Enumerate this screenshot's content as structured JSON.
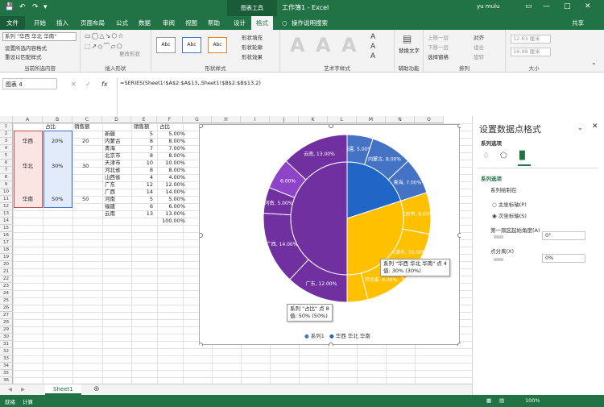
{
  "titlebar": {
    "title": "工作簿1 - Excel",
    "context_tab": "图表工具",
    "user": "yu mulu"
  },
  "tabs": [
    "文件",
    "开始",
    "插入",
    "页面布局",
    "公式",
    "数据",
    "审阅",
    "视图",
    "帮助",
    "设计",
    "格式",
    "操作说明搜索"
  ],
  "share": "共享",
  "ribbon": {
    "selector": "系列 \"华西 华北 华南\"",
    "format_selection": "设置所选内容格式",
    "reset_style": "重设以匹配样式",
    "g1": "当前所选内容",
    "g2": "插入形状",
    "change_shape": "更改形状",
    "style_sample": "Abc",
    "shape_fill": "形状填充",
    "shape_outline": "形状轮廓",
    "shape_effect": "形状效果",
    "g3": "形状样式",
    "g4": "艺术字样式",
    "alt_text": "替换文字",
    "g5": "辅助功能",
    "up": "上移一层",
    "down": "下移一层",
    "selection_pane": "选择窗格",
    "align": "对齐",
    "group": "组合",
    "rotate": "旋转",
    "g6": "排列",
    "height": "12.63 厘米",
    "width": "16.99 厘米",
    "g7": "大小"
  },
  "formula_bar": {
    "name_box": "图表 4",
    "formula": "=SERIES(Sheet1!$A$2:$A$13,,Sheet1!$B$2:$B$13,2)"
  },
  "columns": [
    "A",
    "B",
    "C",
    "D",
    "E",
    "F",
    "G",
    "H",
    "I",
    "J",
    "K",
    "L",
    "M",
    "N",
    "O"
  ],
  "rows": [
    "1",
    "2",
    "3",
    "4",
    "5",
    "6",
    "7",
    "8",
    "9",
    "10",
    "11",
    "12",
    "13",
    "14",
    "15",
    "16",
    "17",
    "18",
    "19",
    "20",
    "21",
    "22",
    "23",
    "24",
    "25",
    "26",
    "27",
    "28",
    "29",
    "30",
    "31",
    "32",
    "33",
    "34",
    "35",
    "36"
  ],
  "table": {
    "headers": {
      "b1": "占比",
      "c1": "销售额",
      "e1": "销售额",
      "f1": "占比"
    },
    "regions": [
      {
        "name": "华西",
        "pct": "20%",
        "sales": "20"
      },
      {
        "name": "华北",
        "pct": "30%",
        "sales": "30"
      },
      {
        "name": "华南",
        "pct": "50%",
        "sales": "50"
      }
    ],
    "provinces": [
      {
        "name": "新疆",
        "sales": "5",
        "pct": "5.00%"
      },
      {
        "name": "内蒙古",
        "sales": "8",
        "pct": "8.00%"
      },
      {
        "name": "青海",
        "sales": "7",
        "pct": "7.00%"
      },
      {
        "name": "北京市",
        "sales": "8",
        "pct": "8.00%"
      },
      {
        "name": "天津市",
        "sales": "10",
        "pct": "10.00%"
      },
      {
        "name": "河北省",
        "sales": "8",
        "pct": "8.00%"
      },
      {
        "name": "山西省",
        "sales": "4",
        "pct": "4.00%"
      },
      {
        "name": "广东",
        "sales": "12",
        "pct": "12.00%"
      },
      {
        "name": "广西",
        "sales": "14",
        "pct": "14.00%"
      },
      {
        "name": "河南",
        "sales": "5",
        "pct": "5.00%"
      },
      {
        "name": "福建",
        "sales": "6",
        "pct": "6.00%"
      },
      {
        "name": "云南",
        "sales": "13",
        "pct": "13.00%"
      }
    ],
    "total": "100.00%"
  },
  "chart_data": {
    "type": "pie",
    "title": "",
    "series": [
      {
        "name": "系列1",
        "categories": [
          "新疆",
          "内蒙古",
          "青海",
          "北京市",
          "天津市",
          "河北省",
          "山西省",
          "广东",
          "广西",
          "河南",
          "福建",
          "云南"
        ],
        "values": [
          5,
          8,
          7,
          8,
          10,
          8,
          4,
          12,
          14,
          5,
          6,
          13
        ],
        "ring": "outer",
        "labels": [
          "新疆, 5.00%",
          "内蒙古, 8.00%",
          "青海, 7.00%",
          "北京市, 8.00%",
          "天津市, 10.00%",
          "河北省, 8.00%",
          "",
          "广东, 12.00%",
          "广西, 14.00%",
          "河南, 5.00%",
          "6.00%",
          "云南, 13.00%"
        ]
      },
      {
        "name": "华西 华北 华南",
        "categories": [
          "华西",
          "华北",
          "华南"
        ],
        "values": [
          20,
          30,
          50
        ],
        "ring": "inner",
        "axis": "secondary"
      }
    ],
    "legend": [
      "系列1",
      "华西 华北 华南"
    ],
    "legend_position": "bottom",
    "tooltips": [
      {
        "line1": "系列 \"华西 华北 华南\" 点 4",
        "line2": "值: 30% (30%)"
      },
      {
        "line1": "系列 \"占比\" 点 8",
        "line2": "值: 50% (50%)"
      }
    ],
    "colors": {
      "blue": "#4472c4",
      "inner_blue": "#1f66c7",
      "yellow": "#ffc000",
      "purple": "#7030a0",
      "light_purple": "#8e44c9"
    }
  },
  "panel": {
    "title": "设置数据点格式",
    "series_options": "系列选项",
    "section": "系列选项",
    "plot_on": "系列绘制在",
    "primary": "主坐标轴(P)",
    "secondary": "次坐标轴(S)",
    "first_angle": "第一扇区起始角度(A)",
    "angle_value": "0°",
    "explosion": "点分离(X)",
    "explosion_value": "0%"
  },
  "sheet_tab": "Sheet1",
  "status": {
    "ready": "就绪",
    "calc": "计算",
    "zoom": "100%"
  }
}
